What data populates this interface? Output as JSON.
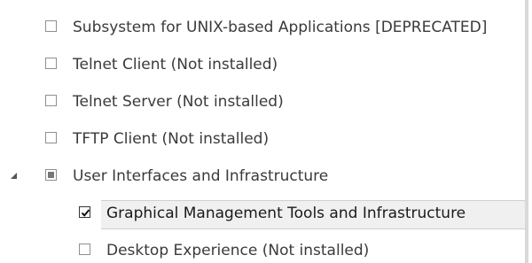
{
  "tree": {
    "items": [
      {
        "label": "Subsystem for UNIX-based Applications [DEPRECATED]",
        "state": "unchecked",
        "level": 1
      },
      {
        "label": "Telnet Client (Not installed)",
        "state": "unchecked",
        "level": 1
      },
      {
        "label": "Telnet Server (Not installed)",
        "state": "unchecked",
        "level": 1
      },
      {
        "label": "TFTP Client (Not installed)",
        "state": "unchecked",
        "level": 1
      },
      {
        "label": "User Interfaces and Infrastructure",
        "state": "partial",
        "level": 1,
        "expander": "expanded-arrow"
      },
      {
        "label": "Graphical Management Tools and Infrastructure",
        "state": "checked",
        "level": 2,
        "selected": true
      },
      {
        "label": "Desktop Experience (Not installed)",
        "state": "unchecked",
        "level": 2
      }
    ]
  }
}
